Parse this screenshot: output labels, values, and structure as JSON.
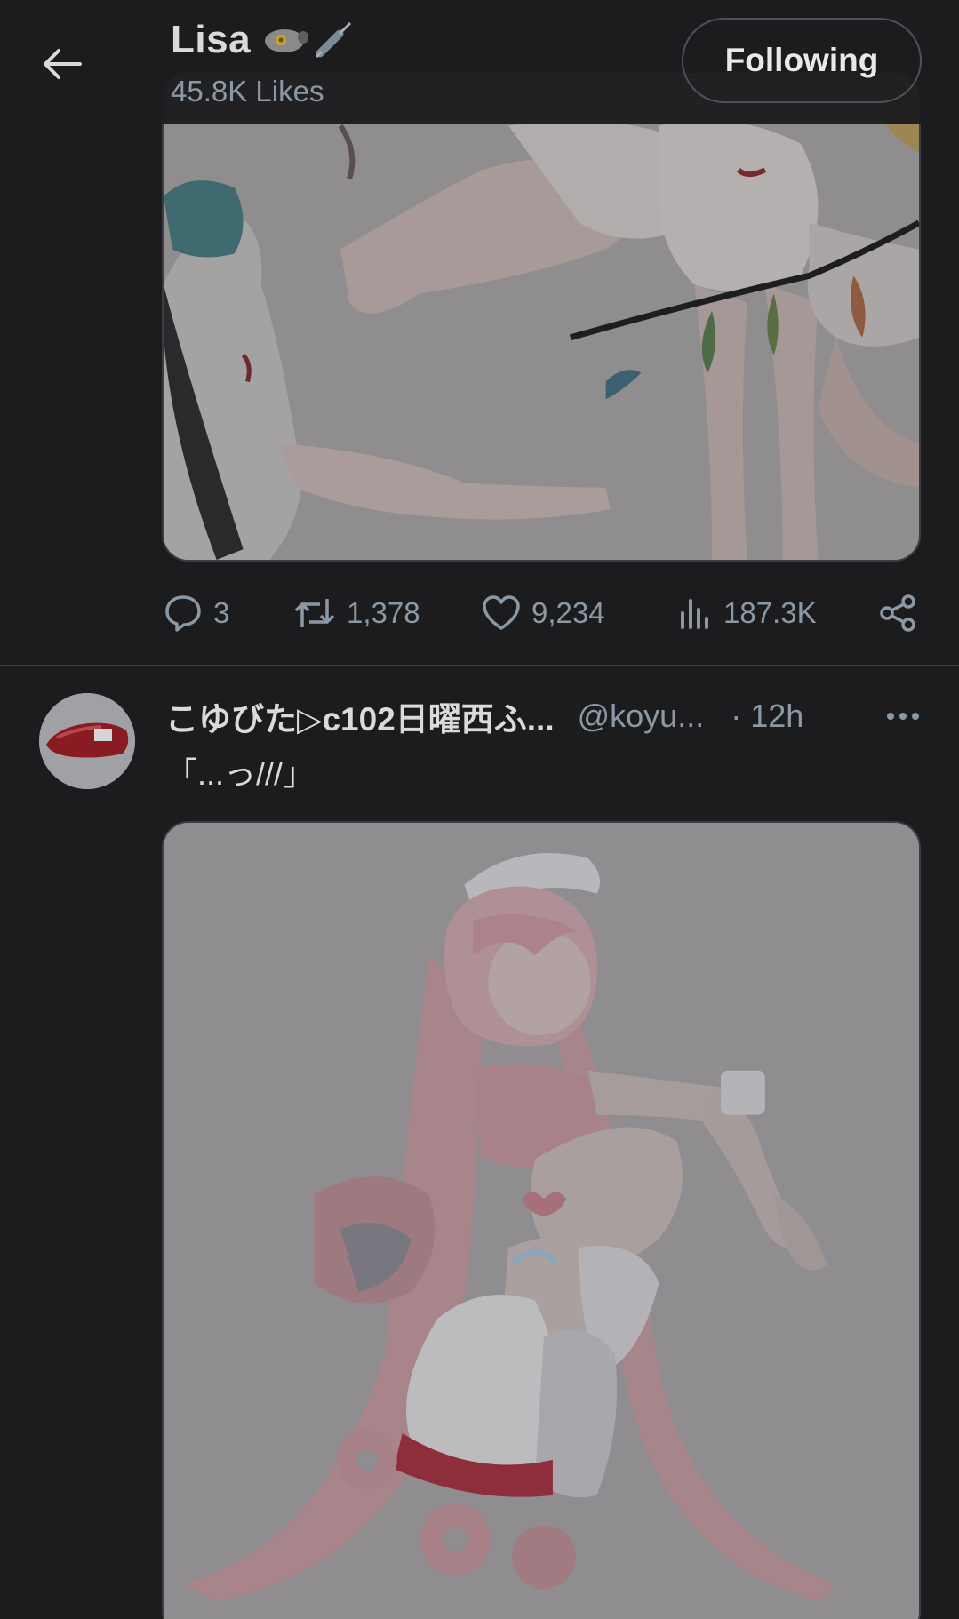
{
  "header": {
    "title": "Lisa",
    "subtitle": "45.8K Likes",
    "follow_label": "Following"
  },
  "tweet1": {
    "stats": {
      "replies": "3",
      "retweets": "1,378",
      "likes": "9,234",
      "views": "187.3K"
    }
  },
  "tweet2": {
    "display_name": "こゆびた▷c102日曜西ふ...",
    "handle": "@koyu...",
    "time": "· 12h",
    "text": "「...っ///」"
  },
  "icons": [
    "arrow-left-icon",
    "reply-icon",
    "retweet-icon",
    "heart-icon",
    "views-icon",
    "share-icon",
    "more-icon"
  ],
  "colors": {
    "background": "#1c1c1e",
    "text": "#e7e9ea",
    "muted": "#8b98a5",
    "border": "#4d5257"
  }
}
